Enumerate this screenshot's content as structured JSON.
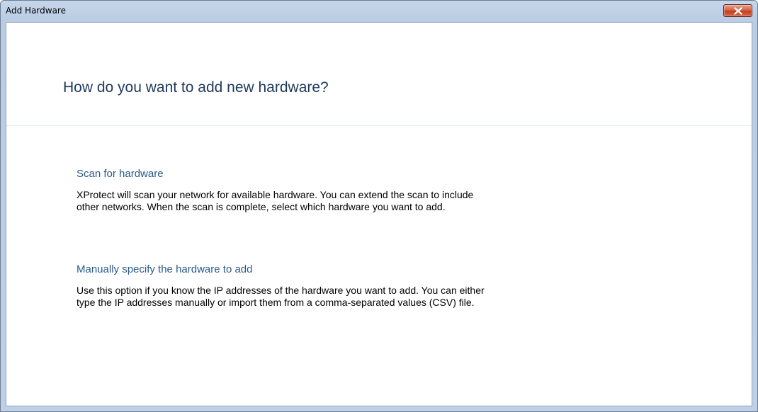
{
  "window": {
    "title": "Add Hardware"
  },
  "page": {
    "heading": "How do you want to add new hardware?"
  },
  "options": [
    {
      "title": "Scan for hardware",
      "description": "XProtect will scan your network for available hardware. You can extend the scan to include\nother networks. When the scan is complete, select which hardware you want to add."
    },
    {
      "title": "Manually specify the hardware to add",
      "description": "Use this option if you know the IP addresses of the hardware you want to add. You can either\ntype the IP addresses manually or import them from a comma-separated values (CSV) file."
    }
  ],
  "icons": {
    "close": "close-icon"
  },
  "colors": {
    "heading": "#1e3a5c",
    "option_title": "#2a5a8a",
    "close_button": "#c23d1f"
  }
}
